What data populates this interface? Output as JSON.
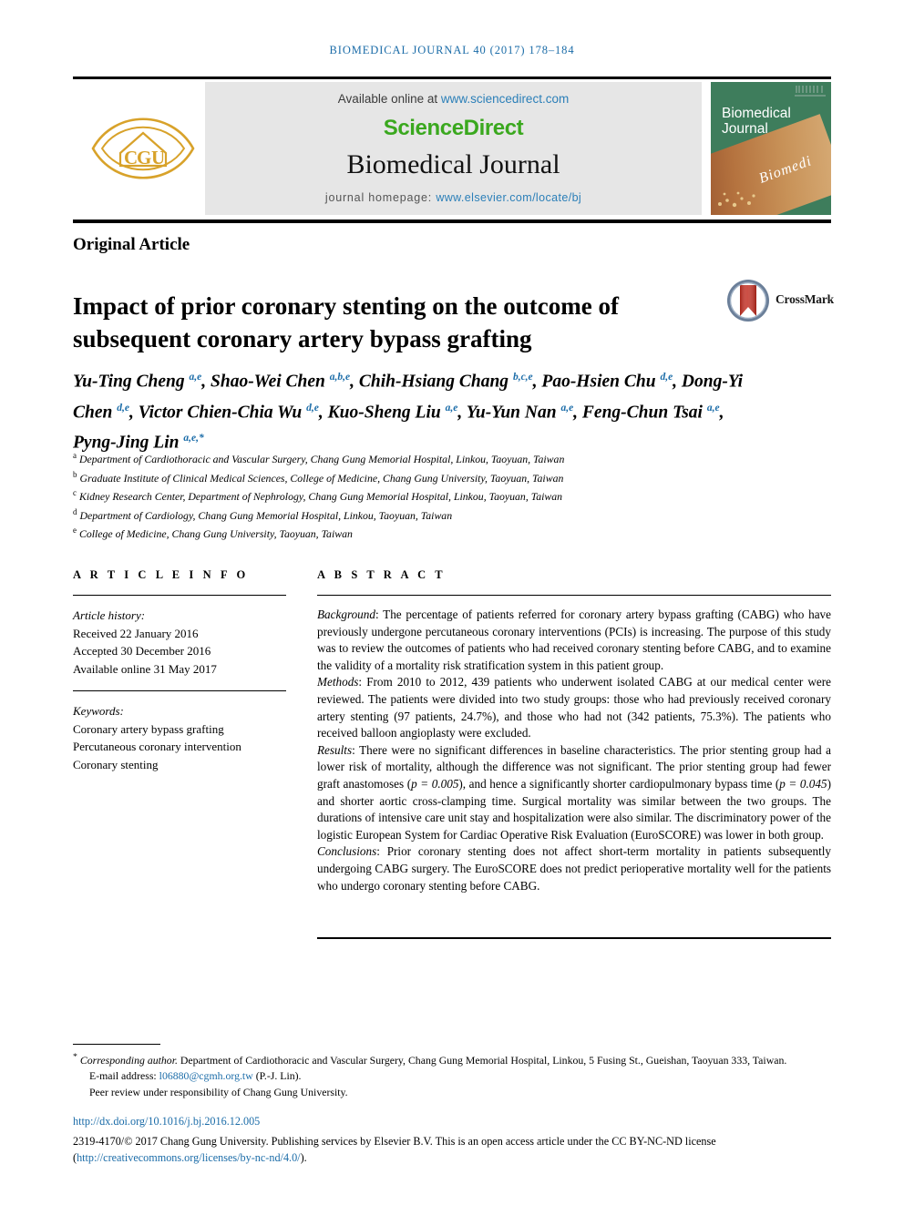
{
  "running_head": "BIOMEDICAL JOURNAL 40 (2017) 178–184",
  "masthead": {
    "available_online_label": "Available online at",
    "sciencedirect_url": "www.sciencedirect.com",
    "sciencedirect_wordmark": "ScienceDirect",
    "journal_name": "Biomedical Journal",
    "homepage_label": "journal homepage:",
    "homepage_url": "www.elsevier.com/locate/bj",
    "publisher_logo_text": "CGU",
    "cover": {
      "title_line1": "Biomedical",
      "title_line2": "Journal",
      "script_text": "Biomedi",
      "background_color": "#3e7d5c"
    },
    "colors": {
      "banner_background": "#e6e6e6",
      "sciencedirect_green": "#3aa81e",
      "link_blue": "#2b7fb8",
      "logo_gold": "#d8a22a"
    }
  },
  "article": {
    "type_label": "Original Article",
    "title": "Impact of prior coronary stenting on the outcome of subsequent coronary artery bypass grafting",
    "crossmark_label": "CrossMark"
  },
  "authors": [
    {
      "name": "Yu-Ting Cheng",
      "affils": "a,e",
      "sep": ", "
    },
    {
      "name": "Shao-Wei Chen",
      "affils": "a,b,e",
      "sep": ", "
    },
    {
      "name": "Chih-Hsiang Chang",
      "affils": "b,c,e",
      "sep": ", "
    },
    {
      "name": "Pao-Hsien Chu",
      "affils": "d,e",
      "sep": ", "
    },
    {
      "name": "Dong-Yi Chen",
      "affils": "d,e",
      "sep": ", "
    },
    {
      "name": "Victor Chien-Chia Wu",
      "affils": "d,e",
      "sep": ", "
    },
    {
      "name": "Kuo-Sheng Liu",
      "affils": "a,e",
      "sep": ", "
    },
    {
      "name": "Yu-Yun Nan",
      "affils": "a,e",
      "sep": ", "
    },
    {
      "name": "Feng-Chun Tsai",
      "affils": "a,e",
      "sep": ", "
    },
    {
      "name": "Pyng-Jing Lin",
      "affils": "a,e,*",
      "sep": ""
    }
  ],
  "affiliations": [
    {
      "mark": "a",
      "text": "Department of Cardiothoracic and Vascular Surgery, Chang Gung Memorial Hospital, Linkou, Taoyuan, Taiwan"
    },
    {
      "mark": "b",
      "text": "Graduate Institute of Clinical Medical Sciences, College of Medicine, Chang Gung University, Taoyuan, Taiwan"
    },
    {
      "mark": "c",
      "text": "Kidney Research Center, Department of Nephrology, Chang Gung Memorial Hospital, Linkou, Taoyuan, Taiwan"
    },
    {
      "mark": "d",
      "text": "Department of Cardiology, Chang Gung Memorial Hospital, Linkou, Taoyuan, Taiwan"
    },
    {
      "mark": "e",
      "text": "College of Medicine, Chang Gung University, Taoyuan, Taiwan"
    }
  ],
  "article_info": {
    "heading": "A R T I C L E  I N F O",
    "history_label": "Article history:",
    "received": "Received 22 January 2016",
    "accepted": "Accepted 30 December 2016",
    "available_online": "Available online 31 May 2017",
    "keywords_label": "Keywords:",
    "keywords": [
      "Coronary artery bypass grafting",
      "Percutaneous coronary intervention",
      "Coronary stenting"
    ]
  },
  "abstract": {
    "heading": "A B S T R A C T",
    "sections": [
      {
        "label": "Background",
        "text": ": The percentage of patients referred for coronary artery bypass grafting (CABG) who have previously undergone percutaneous coronary interventions (PCIs) is increasing. The purpose of this study was to review the outcomes of patients who had received coronary stenting before CABG, and to examine the validity of a mortality risk stratification system in this patient group."
      },
      {
        "label": "Methods",
        "text": ": From 2010 to 2012, 439 patients who underwent isolated CABG at our medical center were reviewed. The patients were divided into two study groups: those who had previously received coronary artery stenting (97 patients, 24.7%), and those who had not (342 patients, 75.3%). The patients who received balloon angioplasty were excluded."
      },
      {
        "label": "Results",
        "text": ": There were no significant differences in baseline characteristics. The prior stenting group had a lower risk of mortality, although the difference was not significant. The prior stenting group had fewer graft anastomoses (p = 0.005), and hence a significantly shorter cardiopulmonary bypass time (p = 0.045) and shorter aortic cross-clamping time. Surgical mortality was similar between the two groups. The durations of intensive care unit stay and hospitalization were also similar. The discriminatory power of the logistic European System for Cardiac Operative Risk Evaluation (EuroSCORE) was lower in both group."
      },
      {
        "label": "Conclusions",
        "text": ": Prior coronary stenting does not affect short-term mortality in patients subsequently undergoing CABG surgery. The EuroSCORE does not predict perioperative mortality well for the patients who undergo coronary stenting before CABG."
      }
    ]
  },
  "footer": {
    "corresponding_label": "Corresponding author.",
    "corresponding_text": " Department of Cardiothoracic and Vascular Surgery, Chang Gung Memorial Hospital, Linkou, 5 Fusing St., Gueishan, Taoyuan 333, Taiwan.",
    "email_label": "E-mail address:",
    "email": "l06880@cgmh.org.tw",
    "email_owner": "(P.-J. Lin).",
    "peer_review": "Peer review under responsibility of Chang Gung University.",
    "doi_url": "http://dx.doi.org/10.1016/j.bj.2016.12.005",
    "copyright_pre": "2319-4170/© 2017 Chang Gung University. Publishing services by Elsevier B.V. This is an open access article under the CC BY-NC-ND license (",
    "license_url": "http://creativecommons.org/licenses/by-nc-nd/4.0/",
    "copyright_post": ")."
  }
}
